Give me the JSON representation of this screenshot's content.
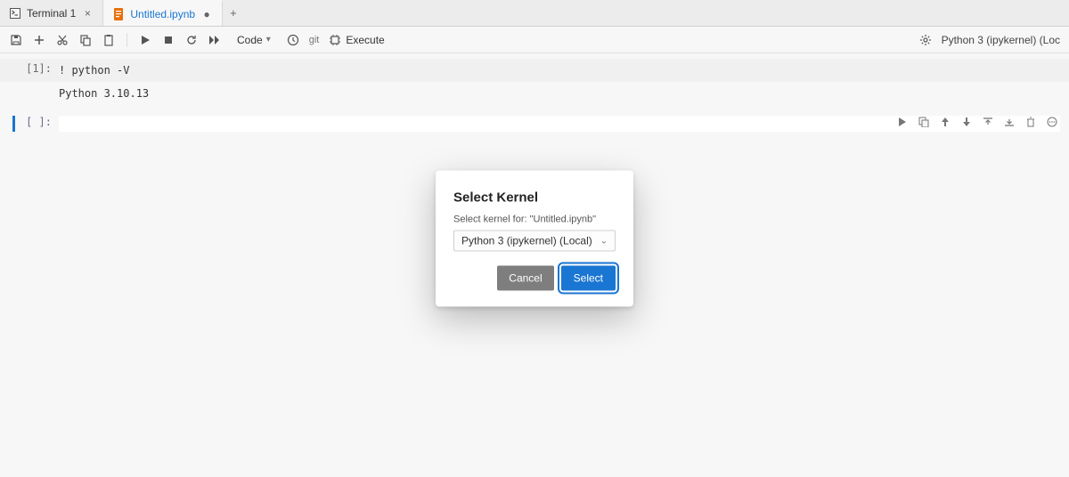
{
  "tabs": [
    {
      "title": "Terminal 1",
      "icon": "terminal-icon",
      "color": "#444",
      "modified": false,
      "active": false
    },
    {
      "title": "Untitled.ipynb",
      "icon": "notebook-icon",
      "color": "#e8710a",
      "modified": true,
      "active": true
    }
  ],
  "toolbar": {
    "celltype": "Code",
    "git_label": "git",
    "execute_label": "Execute"
  },
  "kernel_indicator": "Python 3 (ipykernel) (Loc",
  "cells": [
    {
      "prompt": "[1]:",
      "type": "input",
      "content": "! python -V"
    },
    {
      "prompt": "",
      "type": "output",
      "content": "Python 3.10.13"
    },
    {
      "prompt": "[ ]:",
      "type": "input-active",
      "content": ""
    }
  ],
  "modal": {
    "title": "Select Kernel",
    "subtitle": "Select kernel for: \"Untitled.ipynb\"",
    "selected": "Python 3 (ipykernel) (Local)",
    "cancel": "Cancel",
    "submit": "Select"
  }
}
